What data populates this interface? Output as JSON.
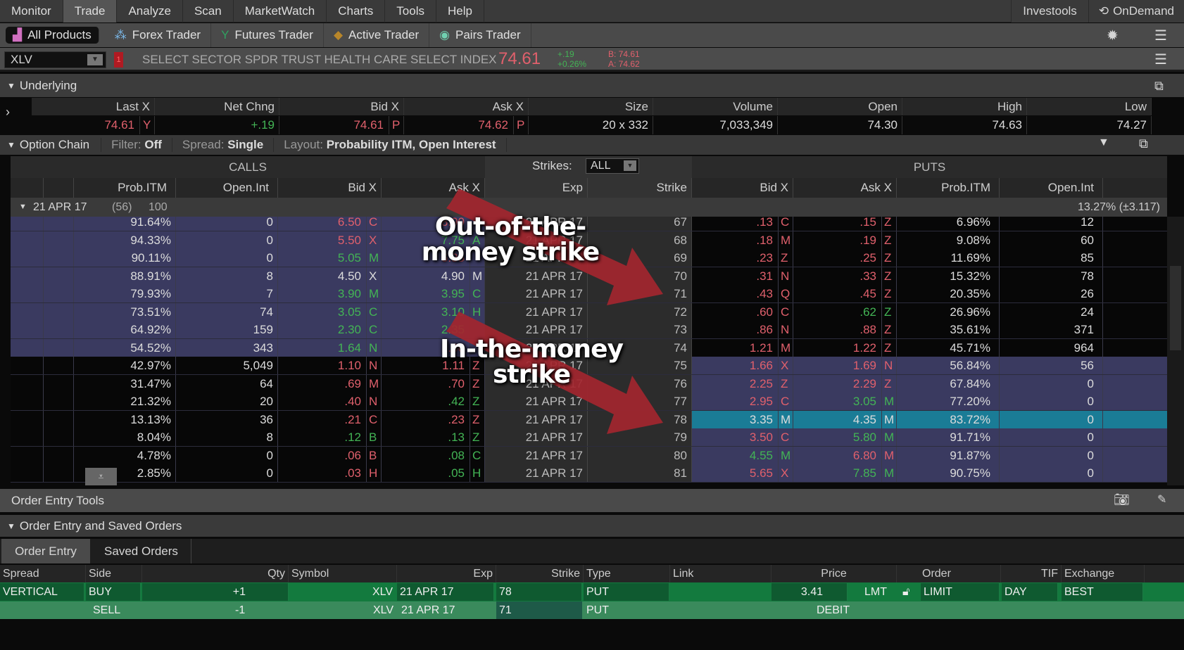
{
  "menu": {
    "items": [
      "Monitor",
      "Trade",
      "Analyze",
      "Scan",
      "MarketWatch",
      "Charts",
      "Tools",
      "Help"
    ],
    "selected": "Trade",
    "right": [
      "Investools",
      "OnDemand"
    ]
  },
  "toolbar": {
    "items": [
      "All Products",
      "Forex Trader",
      "Futures Trader",
      "Active Trader",
      "Pairs Trader"
    ]
  },
  "symbol": {
    "value": "XLV",
    "flag": "1",
    "description": "SELECT SECTOR SPDR TRUST HEALTH CARE SELECT INDEX",
    "last": "74.61",
    "change": "+.19",
    "change_pct": "+0.26%",
    "bid": "B: 74.61",
    "ask": "A: 74.62"
  },
  "underlying": {
    "title": "Underlying",
    "headers": [
      "Last X",
      "Net Chng",
      "Bid X",
      "Ask X",
      "Size",
      "Volume",
      "Open",
      "High",
      "Low"
    ],
    "values": {
      "last": "74.61",
      "last_x": "Y",
      "net": "+.19",
      "bid": "74.61",
      "bid_x": "P",
      "ask": "74.62",
      "ask_x": "P",
      "size": "20 x 332",
      "volume": "7,033,349",
      "open": "74.30",
      "high": "74.63",
      "low": "74.27"
    }
  },
  "chain": {
    "title": "Option Chain",
    "filter_label": "Filter:",
    "filter": "Off",
    "spread_label": "Spread:",
    "spread": "Single",
    "layout_label": "Layout:",
    "layout": "Probability ITM, Open Interest",
    "calls_label": "CALLS",
    "puts_label": "PUTS",
    "strikes_label": "Strikes:",
    "strikes": "ALL",
    "call_headers": [
      "Prob.ITM",
      "Open.Int",
      "Bid X",
      "Ask X"
    ],
    "mid_headers": [
      "Exp",
      "Strike"
    ],
    "put_headers": [
      "Bid X",
      "Ask X",
      "Prob.ITM",
      "Open.Int"
    ],
    "expiry": {
      "label": "21 APR 17",
      "days": "(56)",
      "mult": "100",
      "implied": "13.27% (±3.117)"
    },
    "colors": {
      "itm": "#3a3a60",
      "otm": "#070707",
      "selected": "#1a7c96",
      "red": "#e0606c",
      "green": "#43b455"
    },
    "rows": [
      {
        "strike": "67",
        "exp": "21 APR 17",
        "c": [
          "91.64%",
          "0",
          "6.50",
          "C",
          "r",
          "8.90",
          "",
          "r"
        ],
        "p": [
          ".13",
          "C",
          "r",
          ".15",
          "Z",
          "r",
          "6.96%",
          "12"
        ]
      },
      {
        "strike": "68",
        "exp": "21 APR 17",
        "c": [
          "94.33%",
          "0",
          "5.50",
          "X",
          "r",
          "7.75",
          "A",
          "g"
        ],
        "p": [
          ".18",
          "M",
          "r",
          ".19",
          "Z",
          "r",
          "9.08%",
          "60"
        ]
      },
      {
        "strike": "69",
        "exp": "21 APR 17",
        "c": [
          "90.11%",
          "0",
          "5.05",
          "M",
          "g",
          "6.35",
          "",
          "r"
        ],
        "p": [
          ".23",
          "Z",
          "r",
          ".25",
          "Z",
          "r",
          "11.69%",
          "85"
        ]
      },
      {
        "strike": "70",
        "exp": "21 APR 17",
        "c": [
          "88.91%",
          "8",
          "4.50",
          "X",
          "w",
          "4.90",
          "M",
          "w"
        ],
        "p": [
          ".31",
          "N",
          "r",
          ".33",
          "Z",
          "r",
          "15.32%",
          "78"
        ]
      },
      {
        "strike": "71",
        "exp": "21 APR 17",
        "c": [
          "79.93%",
          "7",
          "3.90",
          "M",
          "g",
          "3.95",
          "C",
          "g"
        ],
        "p": [
          ".43",
          "Q",
          "r",
          ".45",
          "Z",
          "r",
          "20.35%",
          "26"
        ]
      },
      {
        "strike": "72",
        "exp": "21 APR 17",
        "c": [
          "73.51%",
          "74",
          "3.05",
          "C",
          "g",
          "3.10",
          "H",
          "g"
        ],
        "p": [
          ".60",
          "C",
          "r",
          ".62",
          "Z",
          "g",
          "26.96%",
          "24"
        ]
      },
      {
        "strike": "73",
        "exp": "21 APR 17",
        "c": [
          "64.92%",
          "159",
          "2.30",
          "C",
          "g",
          "2.35",
          "",
          "g"
        ],
        "p": [
          ".86",
          "N",
          "r",
          ".88",
          "Z",
          "r",
          "35.61%",
          "371"
        ]
      },
      {
        "strike": "74",
        "exp": "21 APR 17",
        "c": [
          "54.52%",
          "343",
          "1.64",
          "N",
          "g",
          "1.66",
          "",
          "r"
        ],
        "p": [
          "1.21",
          "M",
          "r",
          "1.22",
          "Z",
          "r",
          "45.71%",
          "964"
        ]
      },
      {
        "strike": "75",
        "exp": "21 APR 17",
        "c": [
          "42.97%",
          "5,049",
          "1.10",
          "N",
          "r",
          "1.11",
          "Z",
          "r"
        ],
        "p": [
          "1.66",
          "X",
          "r",
          "1.69",
          "N",
          "r",
          "56.84%",
          "56"
        ]
      },
      {
        "strike": "76",
        "exp": "21 APR 17",
        "c": [
          "31.47%",
          "64",
          ".69",
          "M",
          "r",
          ".70",
          "Z",
          "r"
        ],
        "p": [
          "2.25",
          "Z",
          "r",
          "2.29",
          "Z",
          "r",
          "67.84%",
          "0"
        ]
      },
      {
        "strike": "77",
        "exp": "21 APR 17",
        "c": [
          "21.32%",
          "20",
          ".40",
          "N",
          "r",
          ".42",
          "Z",
          "g"
        ],
        "p": [
          "2.95",
          "C",
          "r",
          "3.05",
          "M",
          "g",
          "77.20%",
          "0"
        ]
      },
      {
        "strike": "78",
        "exp": "21 APR 17",
        "c": [
          "13.13%",
          "36",
          ".21",
          "C",
          "r",
          ".23",
          "Z",
          "r"
        ],
        "p": [
          "3.35",
          "M",
          "w",
          "4.35",
          "M",
          "w",
          "83.72%",
          "0"
        ],
        "selected": true
      },
      {
        "strike": "79",
        "exp": "21 APR 17",
        "c": [
          "8.04%",
          "8",
          ".12",
          "B",
          "g",
          ".13",
          "Z",
          "g"
        ],
        "p": [
          "3.50",
          "C",
          "r",
          "5.80",
          "M",
          "g",
          "91.71%",
          "0"
        ]
      },
      {
        "strike": "80",
        "exp": "21 APR 17",
        "c": [
          "4.78%",
          "0",
          ".06",
          "B",
          "r",
          ".08",
          "C",
          "g"
        ],
        "p": [
          "4.55",
          "M",
          "g",
          "6.80",
          "M",
          "r",
          "91.87%",
          "0"
        ]
      },
      {
        "strike": "81",
        "exp": "21 APR 17",
        "c": [
          "2.85%",
          "0",
          ".03",
          "H",
          "r",
          ".05",
          "H",
          "g"
        ],
        "p": [
          "5.65",
          "X",
          "r",
          "7.85",
          "M",
          "g",
          "90.75%",
          "0"
        ]
      }
    ]
  },
  "annotations": {
    "otm": "Out-of-the-money strike",
    "itm": "In-the-money strike"
  },
  "order_tools": {
    "title": "Order Entry Tools",
    "section": "Order Entry and Saved Orders",
    "tabs": [
      "Order Entry",
      "Saved Orders"
    ],
    "headers": [
      "Spread",
      "Side",
      "Qty",
      "Symbol",
      "Exp",
      "Strike",
      "Type",
      "Link",
      "Price",
      "Order",
      "TIF",
      "Exchange"
    ],
    "leg1": {
      "spread": "VERTICAL",
      "side": "BUY",
      "qty": "+1",
      "symbol": "XLV",
      "exp": "21 APR 17",
      "strike": "78",
      "type": "PUT",
      "price": "3.41",
      "price_type": "LMT",
      "order": "LIMIT",
      "tif": "DAY",
      "exchange": "BEST"
    },
    "leg2": {
      "side": "SELL",
      "qty": "-1",
      "symbol": "XLV",
      "exp": "21 APR 17",
      "strike": "71",
      "type": "PUT",
      "price_note": "DEBIT"
    }
  }
}
